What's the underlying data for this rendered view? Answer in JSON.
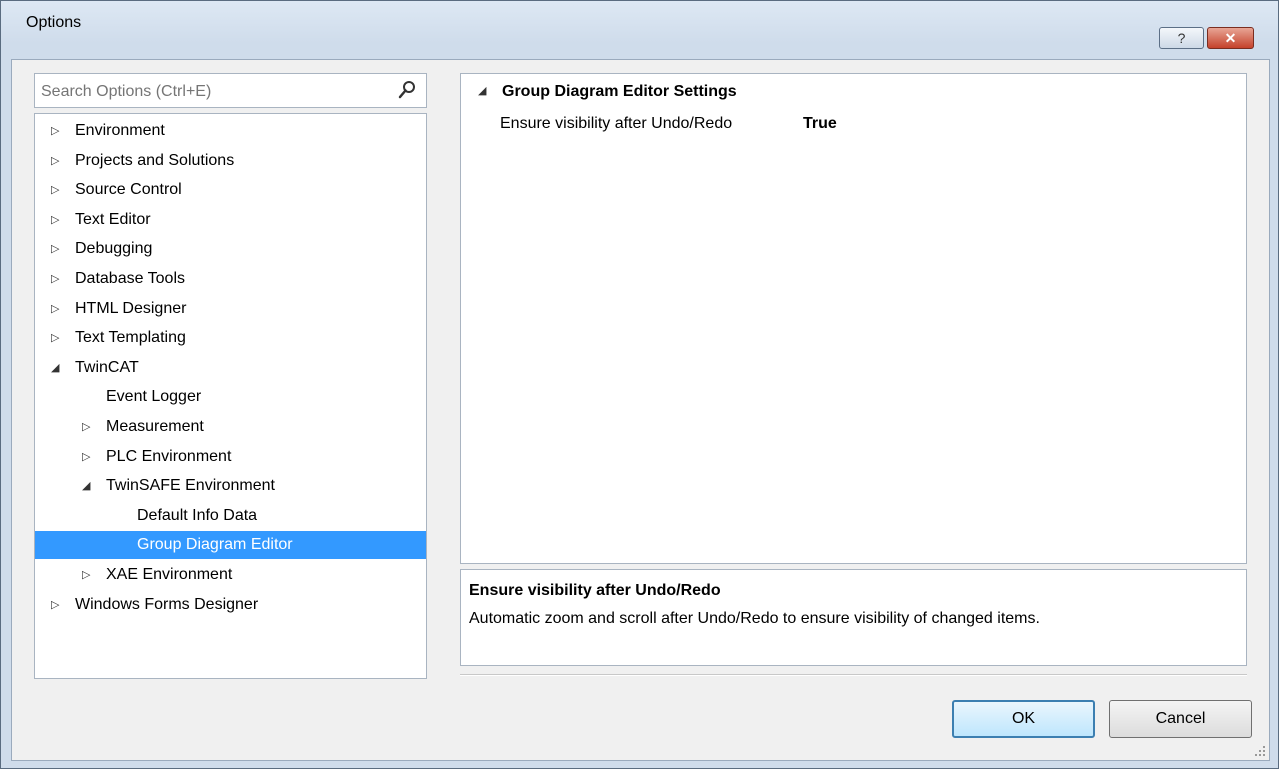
{
  "window": {
    "title": "Options",
    "help_symbol": "?",
    "close_symbol": "✕"
  },
  "search": {
    "placeholder": "Search Options (Ctrl+E)",
    "icon": "search-icon"
  },
  "tree": {
    "items": [
      {
        "label": "Environment",
        "level": 0,
        "state": "collapsed"
      },
      {
        "label": "Projects and Solutions",
        "level": 0,
        "state": "collapsed"
      },
      {
        "label": "Source Control",
        "level": 0,
        "state": "collapsed"
      },
      {
        "label": "Text Editor",
        "level": 0,
        "state": "collapsed"
      },
      {
        "label": "Debugging",
        "level": 0,
        "state": "collapsed"
      },
      {
        "label": "Database Tools",
        "level": 0,
        "state": "collapsed"
      },
      {
        "label": "HTML Designer",
        "level": 0,
        "state": "collapsed"
      },
      {
        "label": "Text Templating",
        "level": 0,
        "state": "collapsed"
      },
      {
        "label": "TwinCAT",
        "level": 0,
        "state": "expanded"
      },
      {
        "label": "Event Logger",
        "level": 1,
        "state": "leaf"
      },
      {
        "label": "Measurement",
        "level": 1,
        "state": "collapsed"
      },
      {
        "label": "PLC Environment",
        "level": 1,
        "state": "collapsed"
      },
      {
        "label": "TwinSAFE Environment",
        "level": 1,
        "state": "expanded"
      },
      {
        "label": "Default Info Data",
        "level": 2,
        "state": "leaf"
      },
      {
        "label": "Group Diagram Editor",
        "level": 2,
        "state": "leaf",
        "selected": true
      },
      {
        "label": "XAE Environment",
        "level": 1,
        "state": "collapsed"
      },
      {
        "label": "Windows Forms Designer",
        "level": 0,
        "state": "collapsed"
      }
    ]
  },
  "property_grid": {
    "category": "Group Diagram Editor Settings",
    "property_name": "Ensure visibility after Undo/Redo",
    "property_value": "True"
  },
  "description": {
    "title": "Ensure visibility after Undo/Redo",
    "text": "Automatic zoom and scroll after Undo/Redo to ensure visibility of changed items."
  },
  "buttons": {
    "ok": "OK",
    "cancel": "Cancel"
  },
  "colors": {
    "selection": "#3399ff",
    "ok_border": "#3c7fb1"
  }
}
